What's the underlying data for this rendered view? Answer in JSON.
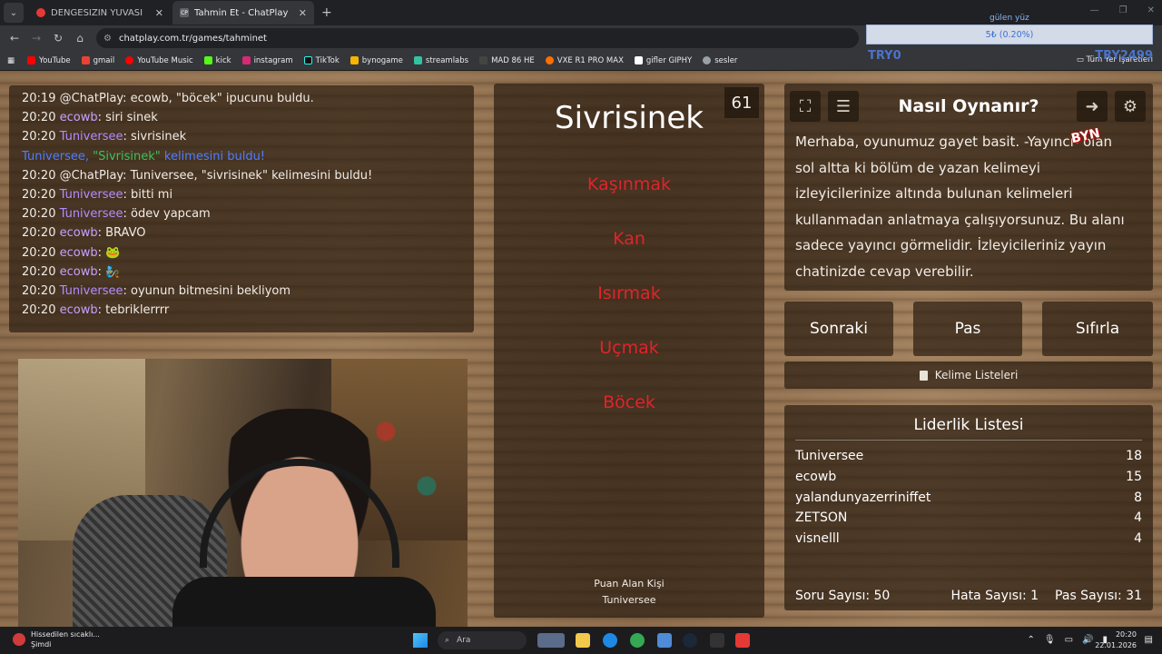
{
  "browser": {
    "tabs": [
      {
        "title": "DENGESİZİN YUVASI",
        "fav_color": "#e53935"
      },
      {
        "title": "Tahmin Et - ChatPlay",
        "fav_color": "#5f6368",
        "fav_text": "CP"
      }
    ],
    "url": "chatplay.com.tr/games/tahminet",
    "bookmarks": [
      {
        "label": "YouTube",
        "color": "#ff0000"
      },
      {
        "label": "gmail",
        "color": "#ea4335"
      },
      {
        "label": "YouTube Music",
        "color": "#ff0000"
      },
      {
        "label": "kick",
        "color": "#53fc18"
      },
      {
        "label": "instagram",
        "color": "#d62976"
      },
      {
        "label": "TikTok",
        "color": "#25f4ee"
      },
      {
        "label": "bynogame",
        "color": "#f5b400"
      },
      {
        "label": "streamlabs",
        "color": "#31c3a2"
      },
      {
        "label": "MAD 86 HE",
        "color": "#444444"
      },
      {
        "label": "VXE R1 PRO MAX",
        "color": "#ff6f00"
      },
      {
        "label": "gifler GIPHY",
        "color": "#ffffff"
      },
      {
        "label": "sesler",
        "color": "#9aa0a6"
      }
    ],
    "bookmarks_right": "Tüm Yer İşaretleri"
  },
  "stream_overlay": {
    "label": "gülen yüz",
    "bar_text": "5₺ (0.20%)",
    "left_text": "TRY0",
    "right_text": "TRY2499"
  },
  "chat": [
    {
      "time": "20:19",
      "user": "@ChatPlay",
      "msg": ": ecowb, \"böcek\" ipucunu buldu.",
      "kind": "sys"
    },
    {
      "time": "20:20",
      "user": "ecowb",
      "msg": ": siri sinek",
      "kind": "u1"
    },
    {
      "time": "20:20",
      "user": "Tuniversee",
      "msg": ": sivrisinek",
      "kind": "u2"
    },
    {
      "time": "",
      "user": "Tuniversee, ",
      "highlight": "\"Sivrisinek\"",
      "msg": " kelimesini buldu!",
      "kind": "hl"
    },
    {
      "time": "20:20",
      "user": "@ChatPlay",
      "msg": ": Tuniversee, \"sivrisinek\" kelimesini buldu!",
      "kind": "sys"
    },
    {
      "time": "20:20",
      "user": "Tuniversee",
      "msg": ": bitti mi",
      "kind": "u2"
    },
    {
      "time": "20:20",
      "user": "Tuniversee",
      "msg": ": ödev yapcam",
      "kind": "u2"
    },
    {
      "time": "20:20",
      "user": "ecowb",
      "msg": ": BRAVO",
      "kind": "u1"
    },
    {
      "time": "20:20",
      "user": "ecowb",
      "msg": ": 🐸",
      "kind": "u1"
    },
    {
      "time": "20:20",
      "user": "ecowb",
      "msg": ": 🧞",
      "kind": "u1"
    },
    {
      "time": "20:20",
      "user": "Tuniversee",
      "msg": ": oyunun bitmesini bekliyom",
      "kind": "u2"
    },
    {
      "time": "20:20",
      "user": "ecowb",
      "msg": ": tebriklerrrr",
      "kind": "u1"
    }
  ],
  "card": {
    "word": "Sivrisinek",
    "timer": "61",
    "taboo_words": [
      "Kaşınmak",
      "Kan",
      "Isırmak",
      "Uçmak",
      "Böcek"
    ],
    "scorer_label": "Puan Alan Kişi",
    "scorer_name": "Tuniversee"
  },
  "help": {
    "title": "Nasıl Oynanır?",
    "text": "Merhaba, oyunumuz gayet basit. -Yayıncı- olan sol altta ki bölüm de yazan kelimeyi izleyicilerinize altında bulunan kelimeleri kullanmadan anlatmaya çalışıyorsunuz. Bu alanı sadece yayıncı görmelidir. İzleyicileriniz yayın chatinizde cevap verebilir.",
    "badge": "BYN"
  },
  "controls": {
    "next": "Sonraki",
    "pass": "Pas",
    "reset": "Sıfırla",
    "word_lists": "Kelime Listeleri"
  },
  "leaderboard": {
    "title": "Liderlik Listesi",
    "rows": [
      {
        "name": "Tuniversee",
        "score": "18"
      },
      {
        "name": "ecowb",
        "score": "15"
      },
      {
        "name": "yalandunyazerriniffet",
        "score": "8"
      },
      {
        "name": "ZETSON",
        "score": "4"
      },
      {
        "name": "visnelll",
        "score": "4"
      }
    ],
    "question_count": "Soru Sayısı: 50",
    "error_count": "Hata Sayısı: 1",
    "pass_count": "Pas Sayısı: 31"
  },
  "taskbar": {
    "weather_line1": "Hissedilen sıcaklı...",
    "weather_line2": "Şimdi",
    "search": "Ara",
    "time": "20:20",
    "date": "22.01.2026"
  }
}
